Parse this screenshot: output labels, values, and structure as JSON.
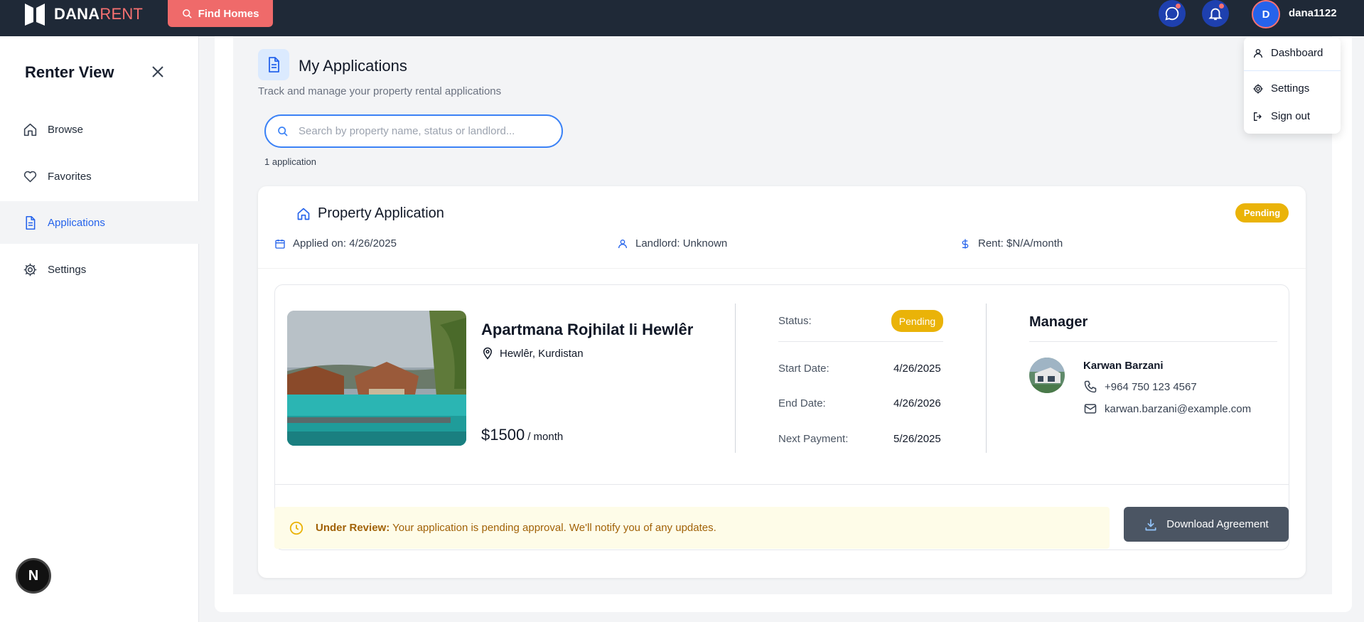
{
  "topbar": {
    "logo_main": "DANA",
    "logo_accent": "RENT",
    "find_homes": "Find Homes",
    "username": "dana1122",
    "avatar_initial": "D"
  },
  "user_menu": {
    "items": [
      {
        "label": "Dashboard",
        "icon": "user-icon"
      },
      {
        "label": "Settings",
        "icon": "gear-icon"
      },
      {
        "label": "Sign out",
        "icon": "sign-out-icon"
      }
    ]
  },
  "sidebar": {
    "title": "Renter View",
    "items": [
      {
        "label": "Browse",
        "icon": "home-icon"
      },
      {
        "label": "Favorites",
        "icon": "heart-icon"
      },
      {
        "label": "Applications",
        "icon": "document-icon",
        "active": true
      },
      {
        "label": "Settings",
        "icon": "gear-icon"
      }
    ],
    "badge": "N"
  },
  "page": {
    "title": "My Applications",
    "subtitle": "Track and manage your property rental applications",
    "search_placeholder": "Search by property name, status or landlord...",
    "count": "1 application"
  },
  "application": {
    "title": "Property Application",
    "status": "Pending",
    "applied_on": "Applied on: 4/26/2025",
    "landlord": "Landlord: Unknown",
    "rent": "Rent: $N/A/month",
    "property": {
      "name": "Apartmana Rojhilat li Hewlêr",
      "location": "Hewlêr, Kurdistan",
      "price": "$1500",
      "price_unit": "/ month"
    },
    "details": {
      "status_label": "Status:",
      "status_value": "Pending",
      "start_label": "Start Date:",
      "start_value": "4/26/2025",
      "end_label": "End Date:",
      "end_value": "4/26/2026",
      "next_label": "Next Payment:",
      "next_value": "5/26/2025"
    },
    "manager": {
      "heading": "Manager",
      "name": "Karwan Barzani",
      "phone": "+964 750 123 4567",
      "email": "karwan.barzani@example.com"
    },
    "review": {
      "label": "Under Review:",
      "text": "Your application is pending approval. We'll notify you of any updates."
    },
    "download": "Download Agreement"
  },
  "colors": {
    "navbar": "#1f2937",
    "accent_red": "#ef6a6a",
    "primary_blue": "#2563eb",
    "pending": "#eab308"
  }
}
